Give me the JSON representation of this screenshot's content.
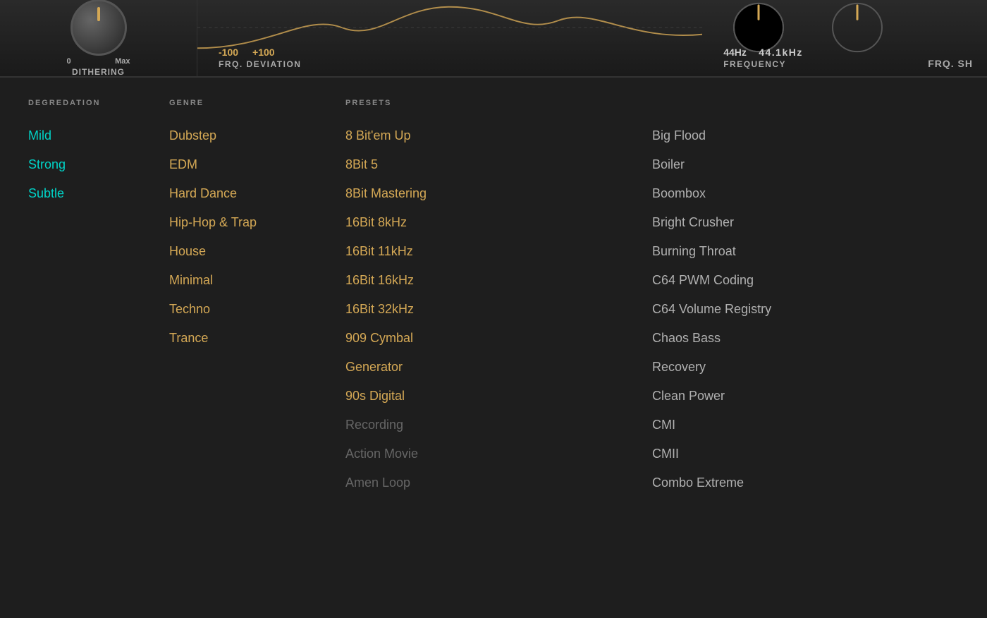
{
  "topPanel": {
    "dithering": {
      "label": "DITHERING",
      "min": "0",
      "max": "Max"
    },
    "frqDeviation": {
      "label": "FRQ. DEVIATION",
      "min": "-100",
      "max": "+100"
    },
    "frequency": {
      "label": "FREQUENCY",
      "value1": "44Hz",
      "value2": "44.1kHz"
    },
    "frqSh": {
      "label": "FRQ. SH"
    }
  },
  "degradation": {
    "header": "DEGREDATION",
    "items": [
      {
        "label": "Mild",
        "style": "cyan"
      },
      {
        "label": "Strong",
        "style": "cyan"
      },
      {
        "label": "Subtle",
        "style": "cyan"
      }
    ]
  },
  "genre": {
    "header": "GENRE",
    "items": [
      {
        "label": "Dubstep",
        "style": "orange"
      },
      {
        "label": "EDM",
        "style": "orange"
      },
      {
        "label": "Hard Dance",
        "style": "orange"
      },
      {
        "label": "Hip-Hop & Trap",
        "style": "orange"
      },
      {
        "label": "House",
        "style": "orange"
      },
      {
        "label": "Minimal",
        "style": "orange"
      },
      {
        "label": "Techno",
        "style": "orange"
      },
      {
        "label": "Trance",
        "style": "orange"
      }
    ]
  },
  "presets": {
    "header": "PRESETS",
    "col1": [
      {
        "label": "8 Bit'em Up",
        "style": "orange"
      },
      {
        "label": "8Bit 5",
        "style": "orange"
      },
      {
        "label": "8Bit Mastering",
        "style": "orange"
      },
      {
        "label": "16Bit 8kHz",
        "style": "orange"
      },
      {
        "label": "16Bit 11kHz",
        "style": "orange"
      },
      {
        "label": "16Bit 16kHz",
        "style": "orange"
      },
      {
        "label": "16Bit 32kHz",
        "style": "orange"
      },
      {
        "label": "909 Cymbal",
        "style": "orange"
      },
      {
        "label": "Generator",
        "style": "orange"
      },
      {
        "label": "90s Digital",
        "style": "orange"
      },
      {
        "label": "Recording",
        "style": "muted"
      },
      {
        "label": "Action Movie",
        "style": "muted"
      },
      {
        "label": "Amen Loop",
        "style": "muted"
      }
    ],
    "col2": [
      {
        "label": "Big Flood",
        "style": "normal"
      },
      {
        "label": "Boiler",
        "style": "normal"
      },
      {
        "label": "Boombox",
        "style": "normal"
      },
      {
        "label": "Bright Crusher",
        "style": "normal"
      },
      {
        "label": "Burning Throat",
        "style": "normal"
      },
      {
        "label": "C64 PWM Coding",
        "style": "normal"
      },
      {
        "label": "C64 Volume Registry",
        "style": "normal"
      },
      {
        "label": "Chaos Bass",
        "style": "normal"
      },
      {
        "label": "Recovery",
        "style": "normal"
      },
      {
        "label": "Clean Power",
        "style": "normal"
      },
      {
        "label": "CMI",
        "style": "normal"
      },
      {
        "label": "CMII",
        "style": "normal"
      },
      {
        "label": "Combo Extreme",
        "style": "normal"
      }
    ]
  }
}
